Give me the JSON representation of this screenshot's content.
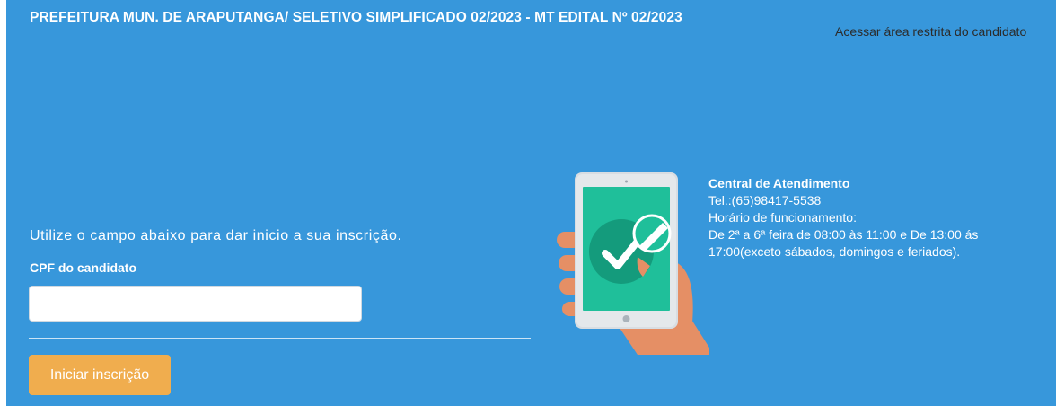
{
  "header": {
    "title": "PREFEITURA MUN. DE ARAPUTANGA/ SELETIVO SIMPLIFICADO 02/2023 - MT EDITAL Nº 02/2023",
    "restricted_area_link": "Acessar área restrita do candidato"
  },
  "form": {
    "intro": "Utilize o campo abaixo para dar inicio a sua inscrição.",
    "cpf_label": "CPF do candidato",
    "cpf_value": "",
    "cpf_placeholder": "",
    "submit_label": "Iniciar inscrição"
  },
  "support": {
    "title": "Central de Atendimento",
    "phone": "Tel.:(65)98417-5538",
    "hours_label": "Horário de funcionamento:",
    "hours_text": "De 2ª a 6ª feira de 08:00 às 11:00 e De 13:00 ás 17:00(exceto sábados, domingos e feriados)."
  },
  "illustration": {
    "icon": "tablet-checkmark-icon"
  },
  "colors": {
    "background": "#3797db",
    "button": "#f0ad4e",
    "screen": "#1fbf9a",
    "hand": "#e58f65"
  }
}
